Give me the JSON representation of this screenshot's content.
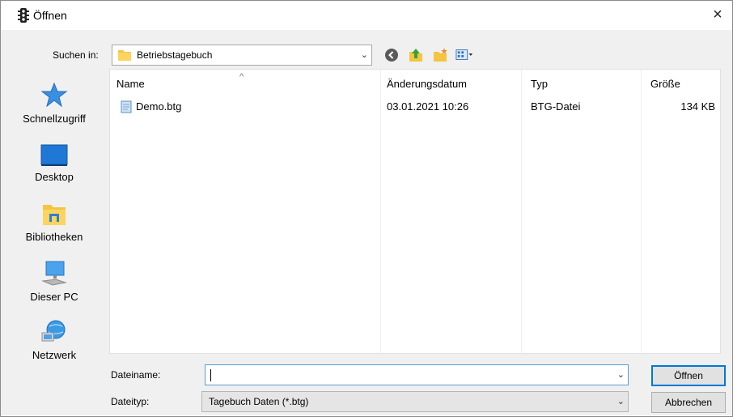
{
  "window": {
    "title": "Öffnen",
    "close_glyph": "×"
  },
  "location": {
    "label": "Suchen in:",
    "value": "Betriebstagebuch",
    "arrow": "⌄"
  },
  "toolbar": {
    "icons": [
      "back-icon",
      "up-folder-icon",
      "new-folder-icon",
      "view-menu-icon"
    ]
  },
  "places": [
    {
      "label": "Schnellzugriff",
      "icon": "star-icon"
    },
    {
      "label": "Desktop",
      "icon": "desktop-icon"
    },
    {
      "label": "Bibliotheken",
      "icon": "libraries-icon"
    },
    {
      "label": "Dieser PC",
      "icon": "computer-icon"
    },
    {
      "label": "Netzwerk",
      "icon": "network-icon"
    }
  ],
  "columns": {
    "name": "Name",
    "date": "Änderungsdatum",
    "type": "Typ",
    "size": "Größe",
    "sort_glyph": "^"
  },
  "files": [
    {
      "name": "Demo.btg",
      "date": "03.01.2021 10:26",
      "type": "BTG-Datei",
      "size": "134 KB"
    }
  ],
  "filename": {
    "label": "Dateiname:",
    "value": "",
    "arrow": "⌄"
  },
  "filetype": {
    "label": "Dateityp:",
    "value": "Tagebuch Daten (*.btg)",
    "arrow": "⌄"
  },
  "buttons": {
    "open": "Öffnen",
    "cancel": "Abbrechen"
  },
  "colors": {
    "accent": "#0078d7",
    "folder": "#f5c542",
    "panel": "#f0f0f0"
  }
}
